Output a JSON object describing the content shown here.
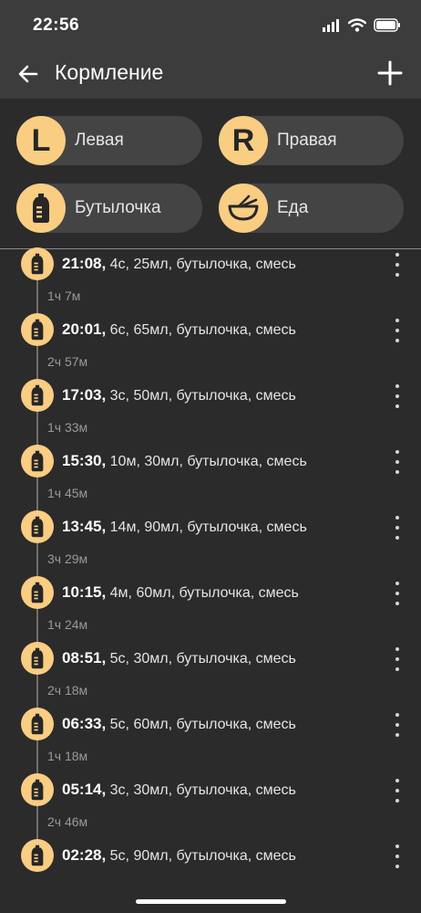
{
  "status": {
    "time": "22:56"
  },
  "header": {
    "title": "Кормление"
  },
  "quick_actions": [
    {
      "letter": "L",
      "label": "Левая",
      "icon": "letter-l-icon"
    },
    {
      "letter": "R",
      "label": "Правая",
      "icon": "letter-r-icon"
    },
    {
      "letter": "",
      "label": "Бутылочка",
      "icon": "bottle-icon"
    },
    {
      "letter": "",
      "label": "Еда",
      "icon": "bowl-icon"
    }
  ],
  "feedings": [
    {
      "time": "21:08,",
      "details": "4с, 25мл, бутылочка, смесь",
      "interval": "1ч 7м"
    },
    {
      "time": "20:01,",
      "details": "6с, 65мл, бутылочка, смесь",
      "interval": "2ч 57м"
    },
    {
      "time": "17:03,",
      "details": "3с, 50мл, бутылочка, смесь",
      "interval": "1ч 33м"
    },
    {
      "time": "15:30,",
      "details": "10м, 30мл, бутылочка, смесь",
      "interval": "1ч 45м"
    },
    {
      "time": "13:45,",
      "details": "14м, 90мл, бутылочка, смесь",
      "interval": "3ч 29м"
    },
    {
      "time": "10:15,",
      "details": "4м, 60мл, бутылочка, смесь",
      "interval": "1ч 24м"
    },
    {
      "time": "08:51,",
      "details": "5с, 30мл, бутылочка, смесь",
      "interval": "2ч 18м"
    },
    {
      "time": "06:33,",
      "details": "5с, 60мл, бутылочка, смесь",
      "interval": "1ч 18м"
    },
    {
      "time": "05:14,",
      "details": "3с, 30мл, бутылочка, смесь",
      "interval": "2ч 46м"
    },
    {
      "time": "02:28,",
      "details": "5с, 90мл, бутылочка, смесь",
      "interval": ""
    }
  ],
  "colors": {
    "accent": "#f9cd82",
    "background": "#2b2b2b",
    "header": "#3c3c3c"
  }
}
